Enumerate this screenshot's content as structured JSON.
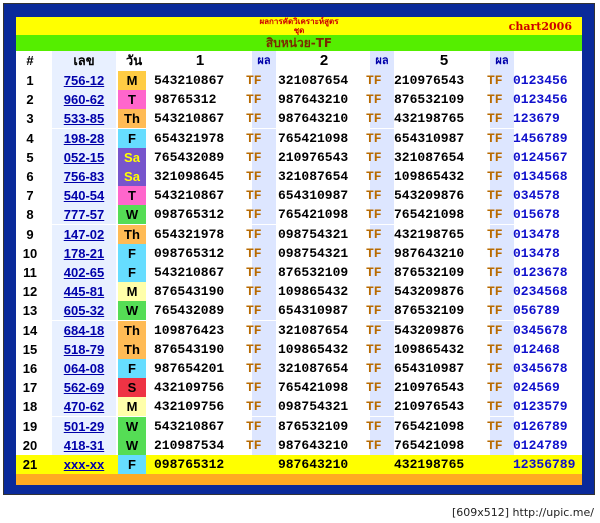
{
  "header": {
    "line1": "ผลการคัดวิเคราะห์สูตร",
    "line2": "ชุด",
    "brand": "chart2006",
    "subtitle": "สิบหน่วย-TF"
  },
  "columns": {
    "num": "#",
    "lek": "เลข",
    "day": "วัน",
    "c1": "1",
    "p1": "ผล",
    "c2": "2",
    "p2": "ผล",
    "c3": "5",
    "p3": "ผล"
  },
  "rows": [
    {
      "num": "1",
      "lek": "756-12",
      "day": "M",
      "dayColor": "#ffcc44",
      "v1": "543210867",
      "p1": "TF",
      "v2": "321087654",
      "p2": "TF",
      "v3": "210976543",
      "p3": "TF",
      "res": "0123456"
    },
    {
      "num": "2",
      "lek": "960-62",
      "day": "T",
      "dayColor": "#ff66cc",
      "v1": "98765312",
      "p1": "TF",
      "v2": "987643210",
      "p2": "TF",
      "v3": "876532109",
      "p3": "TF",
      "res": "0123456"
    },
    {
      "num": "3",
      "lek": "533-85",
      "day": "Th",
      "dayColor": "#ffbb55",
      "v1": "543210867",
      "p1": "TF",
      "v2": "987643210",
      "p2": "TF",
      "v3": "432198765",
      "p3": "TF",
      "res": "123679"
    },
    {
      "num": "4",
      "lek": "198-28",
      "day": "F",
      "dayColor": "#66ddff",
      "v1": "654321978",
      "p1": "TF",
      "v2": "765421098",
      "p2": "TF",
      "v3": "654310987",
      "p3": "TF",
      "res": "1456789"
    },
    {
      "num": "5",
      "lek": "052-15",
      "day": "Sa",
      "dayColor": "#7755cc",
      "v1": "765432089",
      "p1": "TF",
      "v2": "210976543",
      "p2": "TF",
      "v3": "321087654",
      "p3": "TF",
      "res": "0124567"
    },
    {
      "num": "6",
      "lek": "756-83",
      "day": "Sa",
      "dayColor": "#7755cc",
      "v1": "321098645",
      "p1": "TF",
      "v2": "321087654",
      "p2": "TF",
      "v3": "109865432",
      "p3": "TF",
      "res": "0134568"
    },
    {
      "num": "7",
      "lek": "540-54",
      "day": "T",
      "dayColor": "#ff66cc",
      "v1": "543210867",
      "p1": "TF",
      "v2": "654310987",
      "p2": "TF",
      "v3": "543209876",
      "p3": "TF",
      "res": "034578"
    },
    {
      "num": "8",
      "lek": "777-57",
      "day": "W",
      "dayColor": "#55dd55",
      "v1": "098765312",
      "p1": "TF",
      "v2": "765421098",
      "p2": "TF",
      "v3": "765421098",
      "p3": "TF",
      "res": "015678"
    },
    {
      "num": "9",
      "lek": "147-02",
      "day": "Th",
      "dayColor": "#ffbb55",
      "v1": "654321978",
      "p1": "TF",
      "v2": "098754321",
      "p2": "TF",
      "v3": "432198765",
      "p3": "TF",
      "res": "013478"
    },
    {
      "num": "10",
      "lek": "178-21",
      "day": "F",
      "dayColor": "#66ddff",
      "v1": "098765312",
      "p1": "TF",
      "v2": "098754321",
      "p2": "TF",
      "v3": "987643210",
      "p3": "TF",
      "res": "013478"
    },
    {
      "num": "11",
      "lek": "402-65",
      "day": "F",
      "dayColor": "#66ddff",
      "v1": "543210867",
      "p1": "TF",
      "v2": "876532109",
      "p2": "TF",
      "v3": "876532109",
      "p3": "TF",
      "res": "0123678"
    },
    {
      "num": "12",
      "lek": "445-81",
      "day": "M",
      "dayColor": "#ffffaa",
      "v1": "876543190",
      "p1": "TF",
      "v2": "109865432",
      "p2": "TF",
      "v3": "543209876",
      "p3": "TF",
      "res": "0234568"
    },
    {
      "num": "13",
      "lek": "605-32",
      "day": "W",
      "dayColor": "#55dd55",
      "v1": "765432089",
      "p1": "TF",
      "v2": "654310987",
      "p2": "TF",
      "v3": "876532109",
      "p3": "TF",
      "res": "056789"
    },
    {
      "num": "14",
      "lek": "684-18",
      "day": "Th",
      "dayColor": "#ffbb55",
      "v1": "109876423",
      "p1": "TF",
      "v2": "321087654",
      "p2": "TF",
      "v3": "543209876",
      "p3": "TF",
      "res": "0345678"
    },
    {
      "num": "15",
      "lek": "518-79",
      "day": "Th",
      "dayColor": "#ffbb55",
      "v1": "876543190",
      "p1": "TF",
      "v2": "109865432",
      "p2": "TF",
      "v3": "109865432",
      "p3": "TF",
      "res": "012468"
    },
    {
      "num": "16",
      "lek": "064-08",
      "day": "F",
      "dayColor": "#66ddff",
      "v1": "987654201",
      "p1": "TF",
      "v2": "321087654",
      "p2": "TF",
      "v3": "654310987",
      "p3": "TF",
      "res": "0345678"
    },
    {
      "num": "17",
      "lek": "562-69",
      "day": "S",
      "dayColor": "#ee3344",
      "v1": "432109756",
      "p1": "TF",
      "v2": "765421098",
      "p2": "TF",
      "v3": "210976543",
      "p3": "TF",
      "res": "024569"
    },
    {
      "num": "18",
      "lek": "470-62",
      "day": "M",
      "dayColor": "#ffffaa",
      "v1": "432109756",
      "p1": "TF",
      "v2": "098754321",
      "p2": "TF",
      "v3": "210976543",
      "p3": "TF",
      "res": "0123579"
    },
    {
      "num": "19",
      "lek": "501-29",
      "day": "W",
      "dayColor": "#55dd55",
      "v1": "543210867",
      "p1": "TF",
      "v2": "876532109",
      "p2": "TF",
      "v3": "765421098",
      "p3": "TF",
      "res": "0126789"
    },
    {
      "num": "20",
      "lek": "418-31",
      "day": "W",
      "dayColor": "#55dd55",
      "v1": "210987534",
      "p1": "TF",
      "v2": "987643210",
      "p2": "TF",
      "v3": "765421098",
      "p3": "TF",
      "res": "0124789"
    },
    {
      "num": "21",
      "lek": "xxx-xx",
      "day": "F",
      "dayColor": "#66ddff",
      "v1": "098765312",
      "p1": "",
      "v2": "987643210",
      "p2": "",
      "v3": "432198765",
      "p3": "",
      "res": "12356789"
    }
  ],
  "credit": "[609x512] http://upic.me/"
}
